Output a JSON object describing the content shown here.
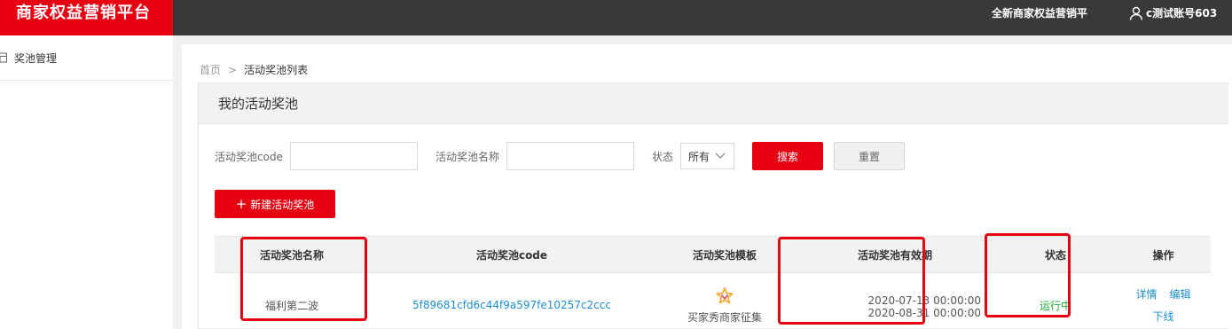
{
  "header": {
    "brand": "商家权益营销平台",
    "nav_text": "全新商家权益营销平台",
    "username": "c测试账号603"
  },
  "sidebar": {
    "items": [
      {
        "label": "奖池管理",
        "icon": "grid-icon"
      }
    ]
  },
  "breadcrumb": {
    "home": "首页",
    "separator": ">",
    "current": "活动奖池列表"
  },
  "panel": {
    "title": "我的活动奖池"
  },
  "filters": {
    "code_label": "活动奖池code",
    "code_value": "",
    "name_label": "活动奖池名称",
    "name_value": "",
    "status_label": "状态",
    "status_value": "所有",
    "search_button": "搜索",
    "reset_button": "重置"
  },
  "new_button": {
    "icon": "+",
    "label": "新建活动奖池"
  },
  "table": {
    "columns": [
      "活动奖池名称",
      "活动奖池code",
      "活动奖池模板",
      "活动奖池有效期",
      "状态",
      "操作"
    ],
    "rows": [
      {
        "name": "福利第二波",
        "code": "5f89681cfd6c44f9a597fe10257c2ccc",
        "template": "买家秀商家征集",
        "start": "2020-07-13 00:00:00",
        "end": "2020-08-31 00:00:00",
        "status": "运行中",
        "actions": {
          "detail": "详情",
          "edit": "编辑",
          "offline": "下线"
        }
      }
    ]
  },
  "colors": {
    "brand_red": "#e60012",
    "topbar": "#393939",
    "link_blue": "#1a8fd6",
    "status_green": "#22aa3a"
  }
}
